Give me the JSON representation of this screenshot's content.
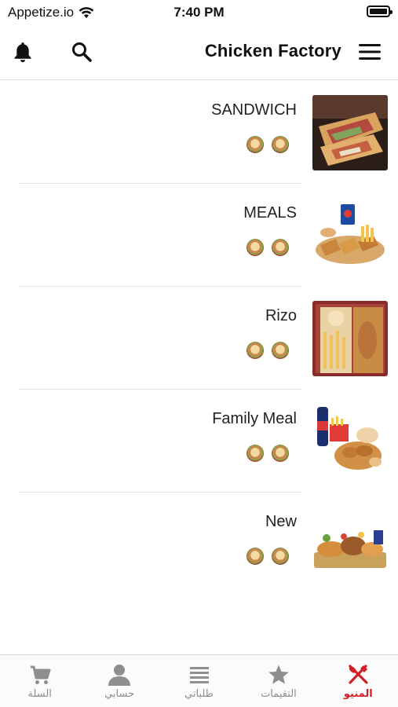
{
  "status_bar": {
    "carrier": "Appetize.io",
    "time": "7:40 PM"
  },
  "header": {
    "title": "Chicken Factory",
    "icons": [
      "bell-icon",
      "search-icon",
      "hamburger-menu-icon"
    ]
  },
  "categories": [
    {
      "name": "SANDWICH",
      "image": "sandwich-wraps"
    },
    {
      "name": "MEALS",
      "image": "fried-chicken-meal"
    },
    {
      "name": "Rizo",
      "image": "rizo-box"
    },
    {
      "name": "Family Meal",
      "image": "family-bucket"
    },
    {
      "name": "New",
      "image": "platter"
    }
  ],
  "tabbar": {
    "tabs": [
      {
        "label": "السلة",
        "icon": "cart-icon",
        "active": false
      },
      {
        "label": "حسابي",
        "icon": "person-icon",
        "active": false
      },
      {
        "label": "طلباتي",
        "icon": "list-icon",
        "active": false
      },
      {
        "label": "التقيمات",
        "icon": "star-icon",
        "active": false
      },
      {
        "label": "المنيو",
        "icon": "fork-knife-icon",
        "active": true
      }
    ]
  },
  "colors": {
    "accent": "#d21f26",
    "inactive": "#8e8e8e",
    "text": "#222222"
  }
}
